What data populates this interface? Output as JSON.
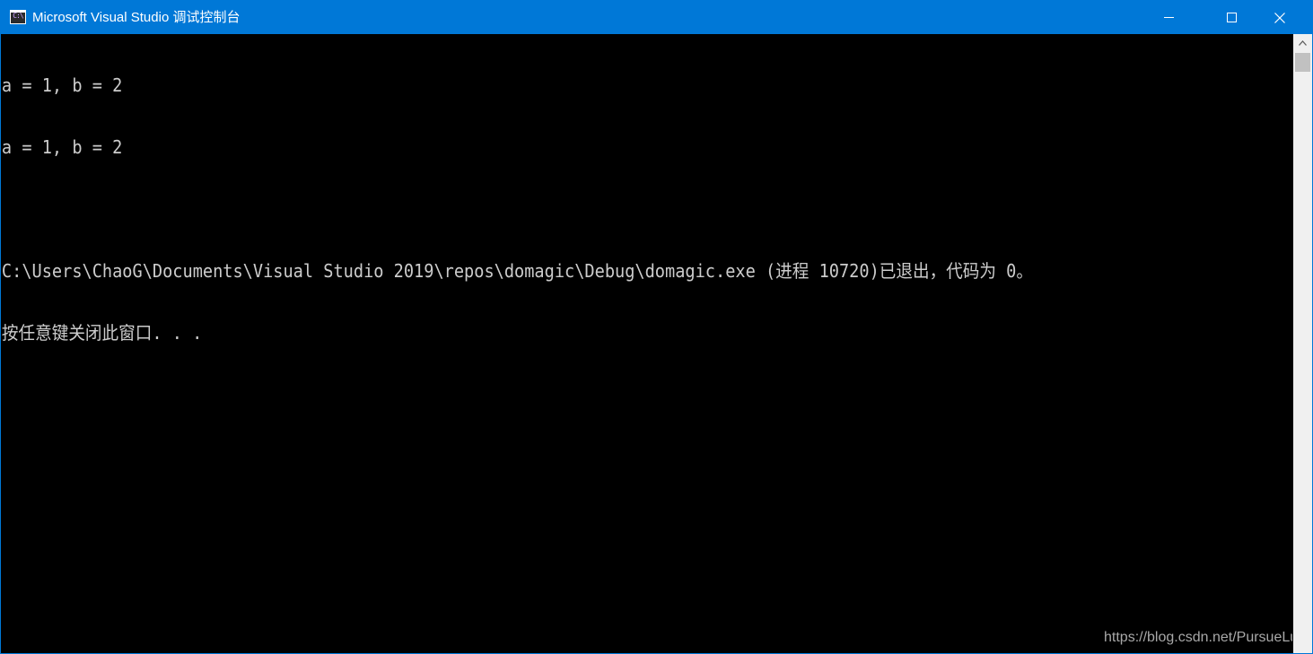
{
  "window": {
    "title": "Microsoft Visual Studio 调试控制台",
    "icon": "console-app-icon",
    "icon_text": "C:\\",
    "titlebar_color": "#0078d7",
    "buttons": [
      "minimize-icon",
      "maximize-icon",
      "close-icon"
    ]
  },
  "console": {
    "background": "#000000",
    "text_color": "#cccccc",
    "lines": [
      "a = 1, b = 2",
      "a = 1, b = 2",
      "",
      "C:\\Users\\ChaoG\\Documents\\Visual Studio 2019\\repos\\domagic\\Debug\\domagic.exe (进程 10720)已退出，代码为 0。",
      "按任意键关闭此窗口. . ."
    ]
  },
  "scrollbar": {
    "up_icon": "scroll-up-arrow-icon"
  },
  "watermark": {
    "text": "https://blog.csdn.net/PursueLuo"
  }
}
